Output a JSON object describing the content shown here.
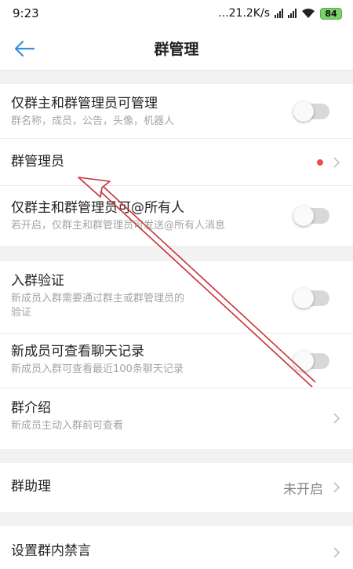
{
  "status_bar": {
    "time": "9:23",
    "speed": "...21.2K/s",
    "battery": "84"
  },
  "nav": {
    "title": "群管理"
  },
  "sections": {
    "s1": {
      "admin_only_manage": {
        "title": "仅群主和群管理员可管理",
        "subtitle": "群名称，成员，公告，头像，机器人",
        "toggle_on": false
      },
      "group_admins": {
        "title": "群管理员"
      },
      "admin_only_at_all": {
        "title": "仅群主和群管理员可@所有人",
        "subtitle": "若开启，仅群主和群管理员可发送@所有人消息",
        "toggle_on": false
      }
    },
    "s2": {
      "join_verification": {
        "title": "入群验证",
        "subtitle_line1": "新成员入群需要通过群主或群管理员的",
        "subtitle_line2": "验证",
        "toggle_on": false
      },
      "view_history": {
        "title": "新成员可查看聊天记录",
        "subtitle": "新成员入群可查看最近100条聊天记录",
        "toggle_on": false
      },
      "group_intro": {
        "title": "群介绍",
        "subtitle": "新成员主动入群前可查看"
      }
    },
    "s3": {
      "group_assistant": {
        "title": "群助理",
        "value": "未开启"
      }
    },
    "s4": {
      "mute": {
        "title": "设置群内禁言"
      }
    }
  },
  "colors": {
    "accent": "#3a8ee6",
    "annotation_arrow": "#c8323a",
    "red_dot": "#f04b48"
  }
}
